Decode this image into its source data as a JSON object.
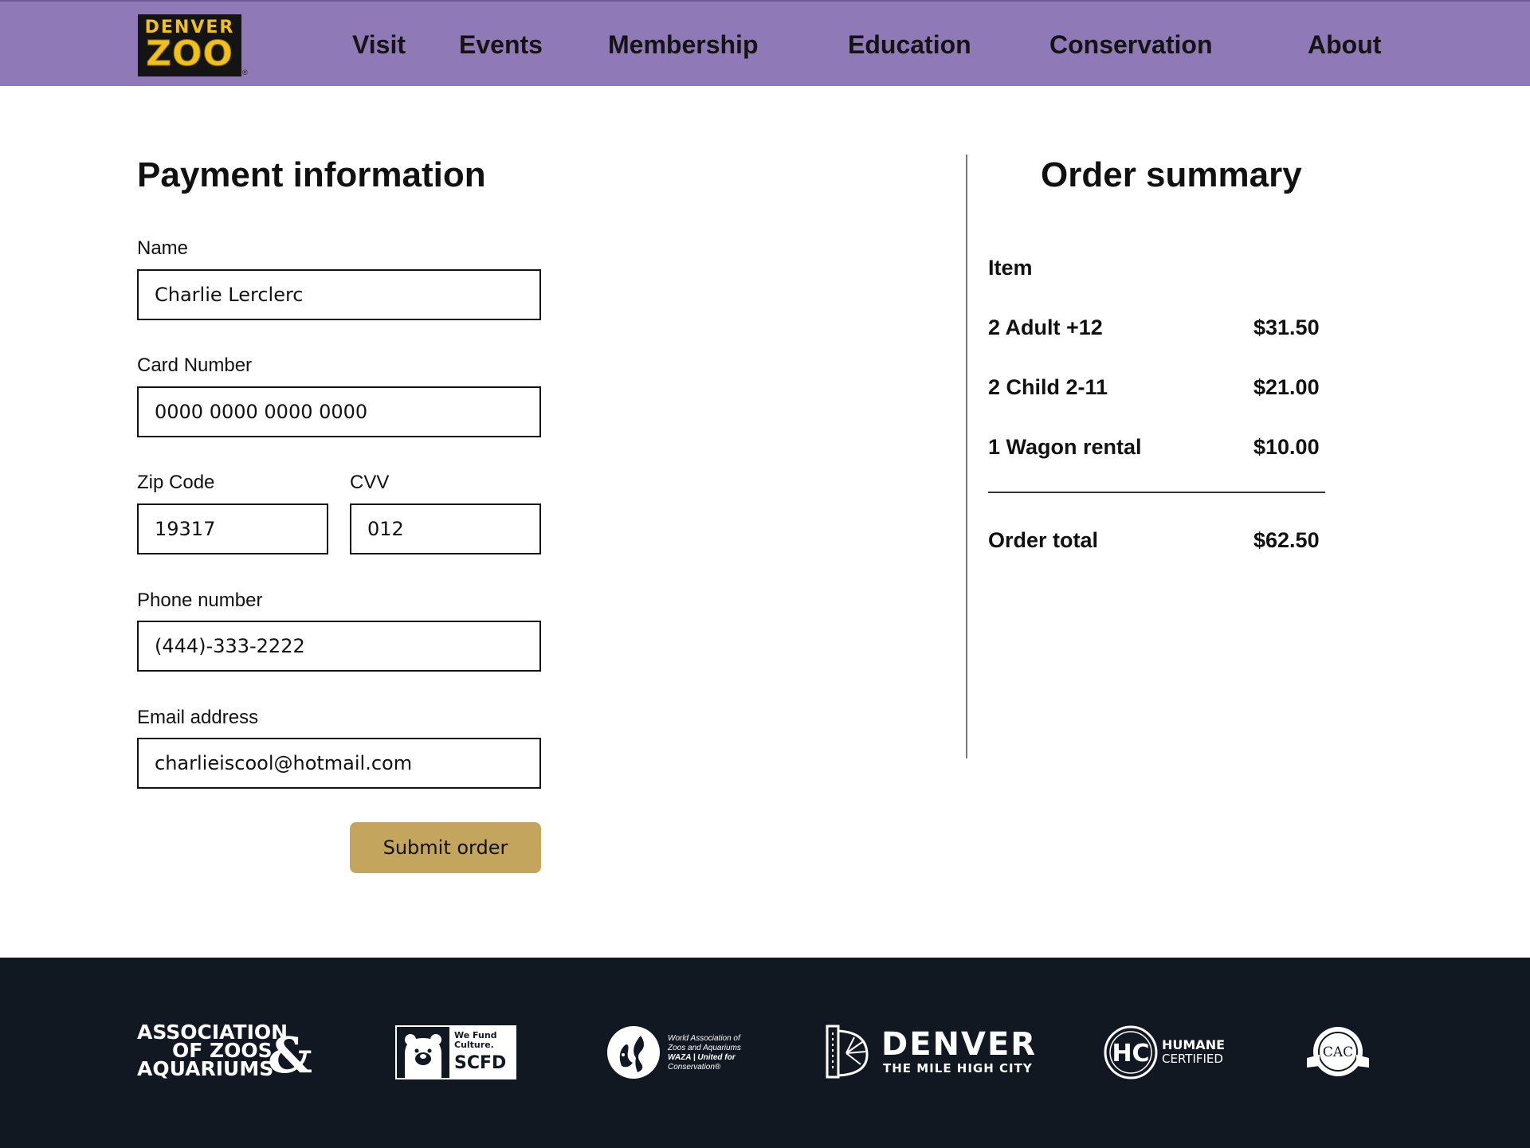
{
  "header": {
    "logo": {
      "top_text": "DENVER",
      "bottom_text": "ZOO",
      "registered_mark": "®"
    },
    "nav": [
      "Visit",
      "Events",
      "Membership",
      "Education",
      "Conservation",
      "About"
    ],
    "background_color": "#8f79b6"
  },
  "payment": {
    "title": "Payment information",
    "name": {
      "label": "Name",
      "value": "Charlie Lerclerc"
    },
    "card": {
      "label": "Card Number",
      "value": "0000 0000 0000 0000"
    },
    "zip": {
      "label": "Zip Code",
      "value": "19317"
    },
    "cvv": {
      "label": "CVV",
      "value": "012"
    },
    "phone": {
      "label": "Phone number",
      "value": "(444)-333-2222"
    },
    "email": {
      "label": "Email address",
      "value": "charlieiscool@hotmail.com"
    },
    "submit_label": "Submit order",
    "submit_color": "#c4a55d"
  },
  "summary": {
    "title": "Order summary",
    "column_header": "Item",
    "items": [
      {
        "name": "2 Adult +12",
        "price": "$31.50"
      },
      {
        "name": "2 Child 2-11",
        "price": "$21.00"
      },
      {
        "name": "1 Wagon rental",
        "price": "$10.00"
      }
    ],
    "total_label": "Order total",
    "total_value": "$62.50"
  },
  "footer": {
    "background_color": "#121822",
    "aza": {
      "lines": [
        "ASSOCIATION",
        "OF ZOOS",
        "AQUARIUMS"
      ],
      "amp": "&"
    },
    "scfd": {
      "line1": "We Fund",
      "line2": "Culture.",
      "name": "SCFD"
    },
    "waza": {
      "lines": [
        "World Association of",
        "Zoos and Aquariums",
        "WAZA | United for",
        "Conservation®"
      ]
    },
    "denver": {
      "name": "DENVER",
      "tagline": "THE MILE HIGH CITY"
    },
    "humane": {
      "mark": "HC",
      "line1": "HUMANE",
      "line2": "CERTIFIED"
    },
    "cac": {
      "mark": "CAC"
    }
  }
}
